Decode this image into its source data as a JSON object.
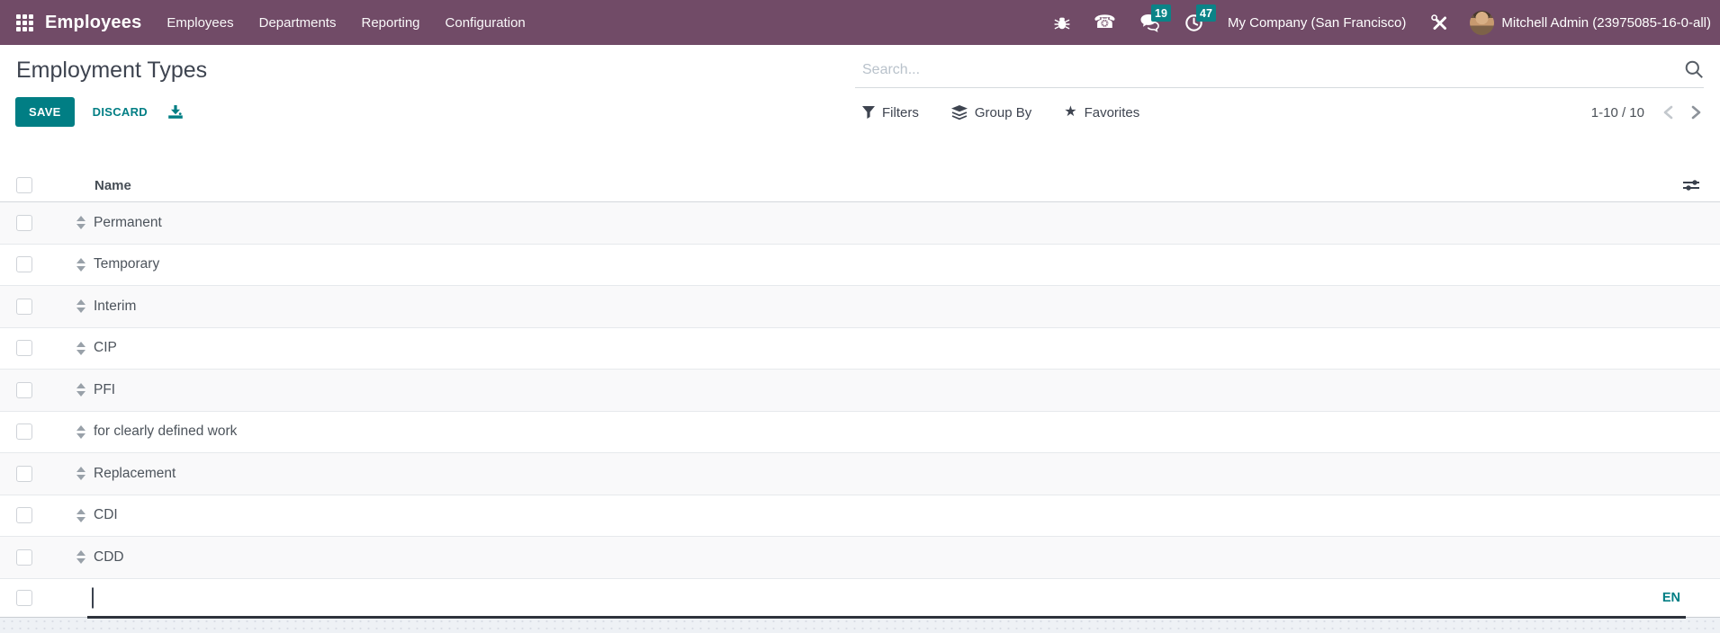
{
  "topbar": {
    "brand": "Employees",
    "menus": [
      "Employees",
      "Departments",
      "Reporting",
      "Configuration"
    ],
    "systray": {
      "message_count": "19",
      "activity_count": "47",
      "company": "My Company (San Francisco)",
      "user": "Mitchell Admin (23975085-16-0-all)"
    }
  },
  "control_panel": {
    "title": "Employment Types",
    "save_label": "SAVE",
    "discard_label": "DISCARD",
    "search": {
      "placeholder": "Search..."
    },
    "filters_label": "Filters",
    "group_by_label": "Group By",
    "favorites_label": "Favorites",
    "pager": {
      "range": "1-10 / 10"
    }
  },
  "table": {
    "name_header": "Name",
    "rows": [
      "Permanent",
      "Temporary",
      "Interim",
      "CIP",
      "PFI",
      "for clearly defined work",
      "Replacement",
      "CDI",
      "CDD"
    ],
    "edit_row": {
      "value": "",
      "language": "EN"
    }
  },
  "icons": {
    "phone": "☎",
    "star": "★"
  },
  "colors": {
    "topbar_bg": "#714B67",
    "primary_teal": "#017E84",
    "badge_bg": "#0B8387",
    "row_stripe": "#F9F9FA",
    "edit_underline": "#2E333C"
  }
}
